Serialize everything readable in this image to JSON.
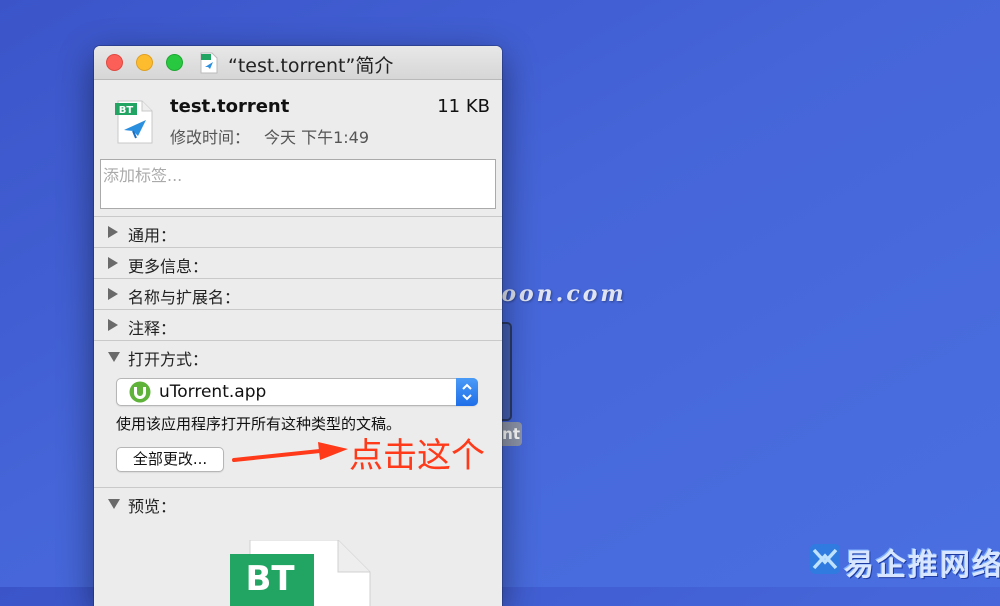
{
  "desktop": {
    "label_fragment": "nt",
    "watermark": "Mac.orsoon.com",
    "brand": "易企推网络",
    "annotation": "点击这个"
  },
  "window": {
    "title": "“test.torrent”简介",
    "file": {
      "name": "test.torrent",
      "size": "11 KB",
      "modified_label": "修改时间：",
      "modified_value": "今天 下午1:49",
      "icon_badge": "BT",
      "icon": "bt-torrent-file-icon"
    },
    "tags": {
      "placeholder": "添加标签...",
      "value": ""
    },
    "sections": [
      {
        "label": "通用：",
        "expanded": false
      },
      {
        "label": "更多信息：",
        "expanded": false
      },
      {
        "label": "名称与扩展名：",
        "expanded": false
      },
      {
        "label": "注释：",
        "expanded": false
      },
      {
        "label": "打开方式：",
        "expanded": true
      },
      {
        "label": "预览：",
        "expanded": true
      }
    ],
    "open_with": {
      "app": "uTorrent.app",
      "description": "使用该应用程序打开所有这种类型的文稿。",
      "change_all_label": "全部更改..."
    },
    "preview": {
      "badge": "BT"
    }
  },
  "colors": {
    "desktop": "#4565d8",
    "bt_green": "#22a563",
    "utorrent_green": "#5fb23a",
    "accent_blue": "#1f6ee8",
    "annotation_red": "#ff3a1a"
  }
}
